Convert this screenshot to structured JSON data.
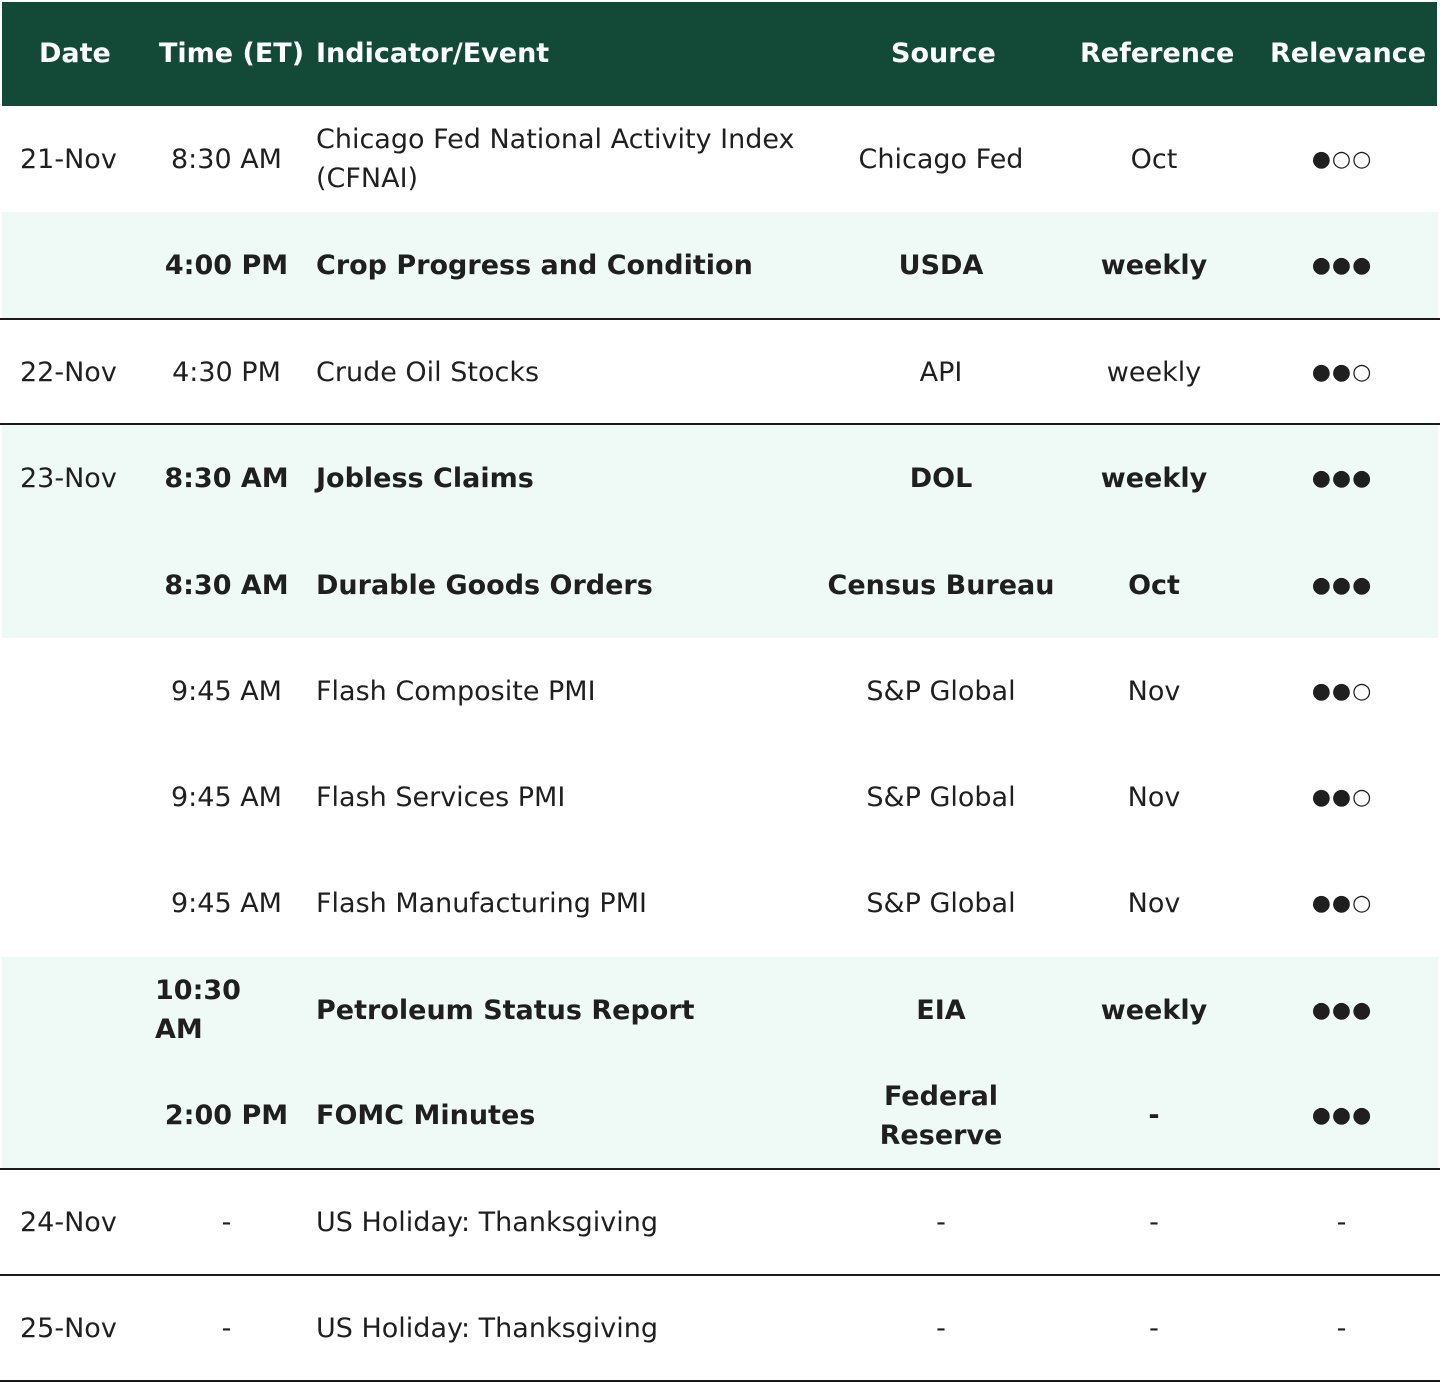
{
  "header": {
    "date": "Date",
    "time": "Time (ET)",
    "indicator": "Indicator/Event",
    "source": "Source",
    "reference": "Reference",
    "relevance": "Relevance"
  },
  "rows": [
    {
      "date": "21-Nov",
      "time": "8:30 AM",
      "indicator": "Chicago Fed National Activity Index (CFNAI)",
      "source": "Chicago Fed",
      "reference": "Oct",
      "relevance": "●○○"
    },
    {
      "date": "",
      "time": "4:00 PM",
      "indicator": "Crop Progress and Condition",
      "source": "USDA",
      "reference": "weekly",
      "relevance": "●●●"
    },
    {
      "date": "22-Nov",
      "time": "4:30 PM",
      "indicator": "Crude Oil Stocks",
      "source": "API",
      "reference": "weekly",
      "relevance": "●●○"
    },
    {
      "date": "23-Nov",
      "time": "8:30 AM",
      "indicator": "Jobless Claims",
      "source": "DOL",
      "reference": "weekly",
      "relevance": "●●●"
    },
    {
      "date": "",
      "time": "8:30 AM",
      "indicator": "Durable Goods Orders",
      "source": "Census Bureau",
      "reference": "Oct",
      "relevance": "●●●"
    },
    {
      "date": "",
      "time": "9:45 AM",
      "indicator": "Flash Composite PMI",
      "source": "S&P Global",
      "reference": "Nov",
      "relevance": "●●○"
    },
    {
      "date": "",
      "time": "9:45 AM",
      "indicator": "Flash Services PMI",
      "source": "S&P Global",
      "reference": "Nov",
      "relevance": "●●○"
    },
    {
      "date": "",
      "time": "9:45 AM",
      "indicator": "Flash Manufacturing PMI",
      "source": "S&P Global",
      "reference": "Nov",
      "relevance": "●●○"
    },
    {
      "date": "",
      "time": "10:30 AM",
      "indicator": "Petroleum Status Report",
      "source": "EIA",
      "reference": "weekly",
      "relevance": "●●●"
    },
    {
      "date": "",
      "time": "2:00 PM",
      "indicator": "FOMC Minutes",
      "source": "Federal Reserve",
      "reference": "-",
      "relevance": "●●●"
    },
    {
      "date": "24-Nov",
      "time": "-",
      "indicator": "US Holiday: Thanksgiving",
      "source": "-",
      "reference": "-",
      "relevance": "-"
    },
    {
      "date": "25-Nov",
      "time": "-",
      "indicator": "US Holiday: Thanksgiving",
      "source": "-",
      "reference": "-",
      "relevance": "-"
    }
  ]
}
